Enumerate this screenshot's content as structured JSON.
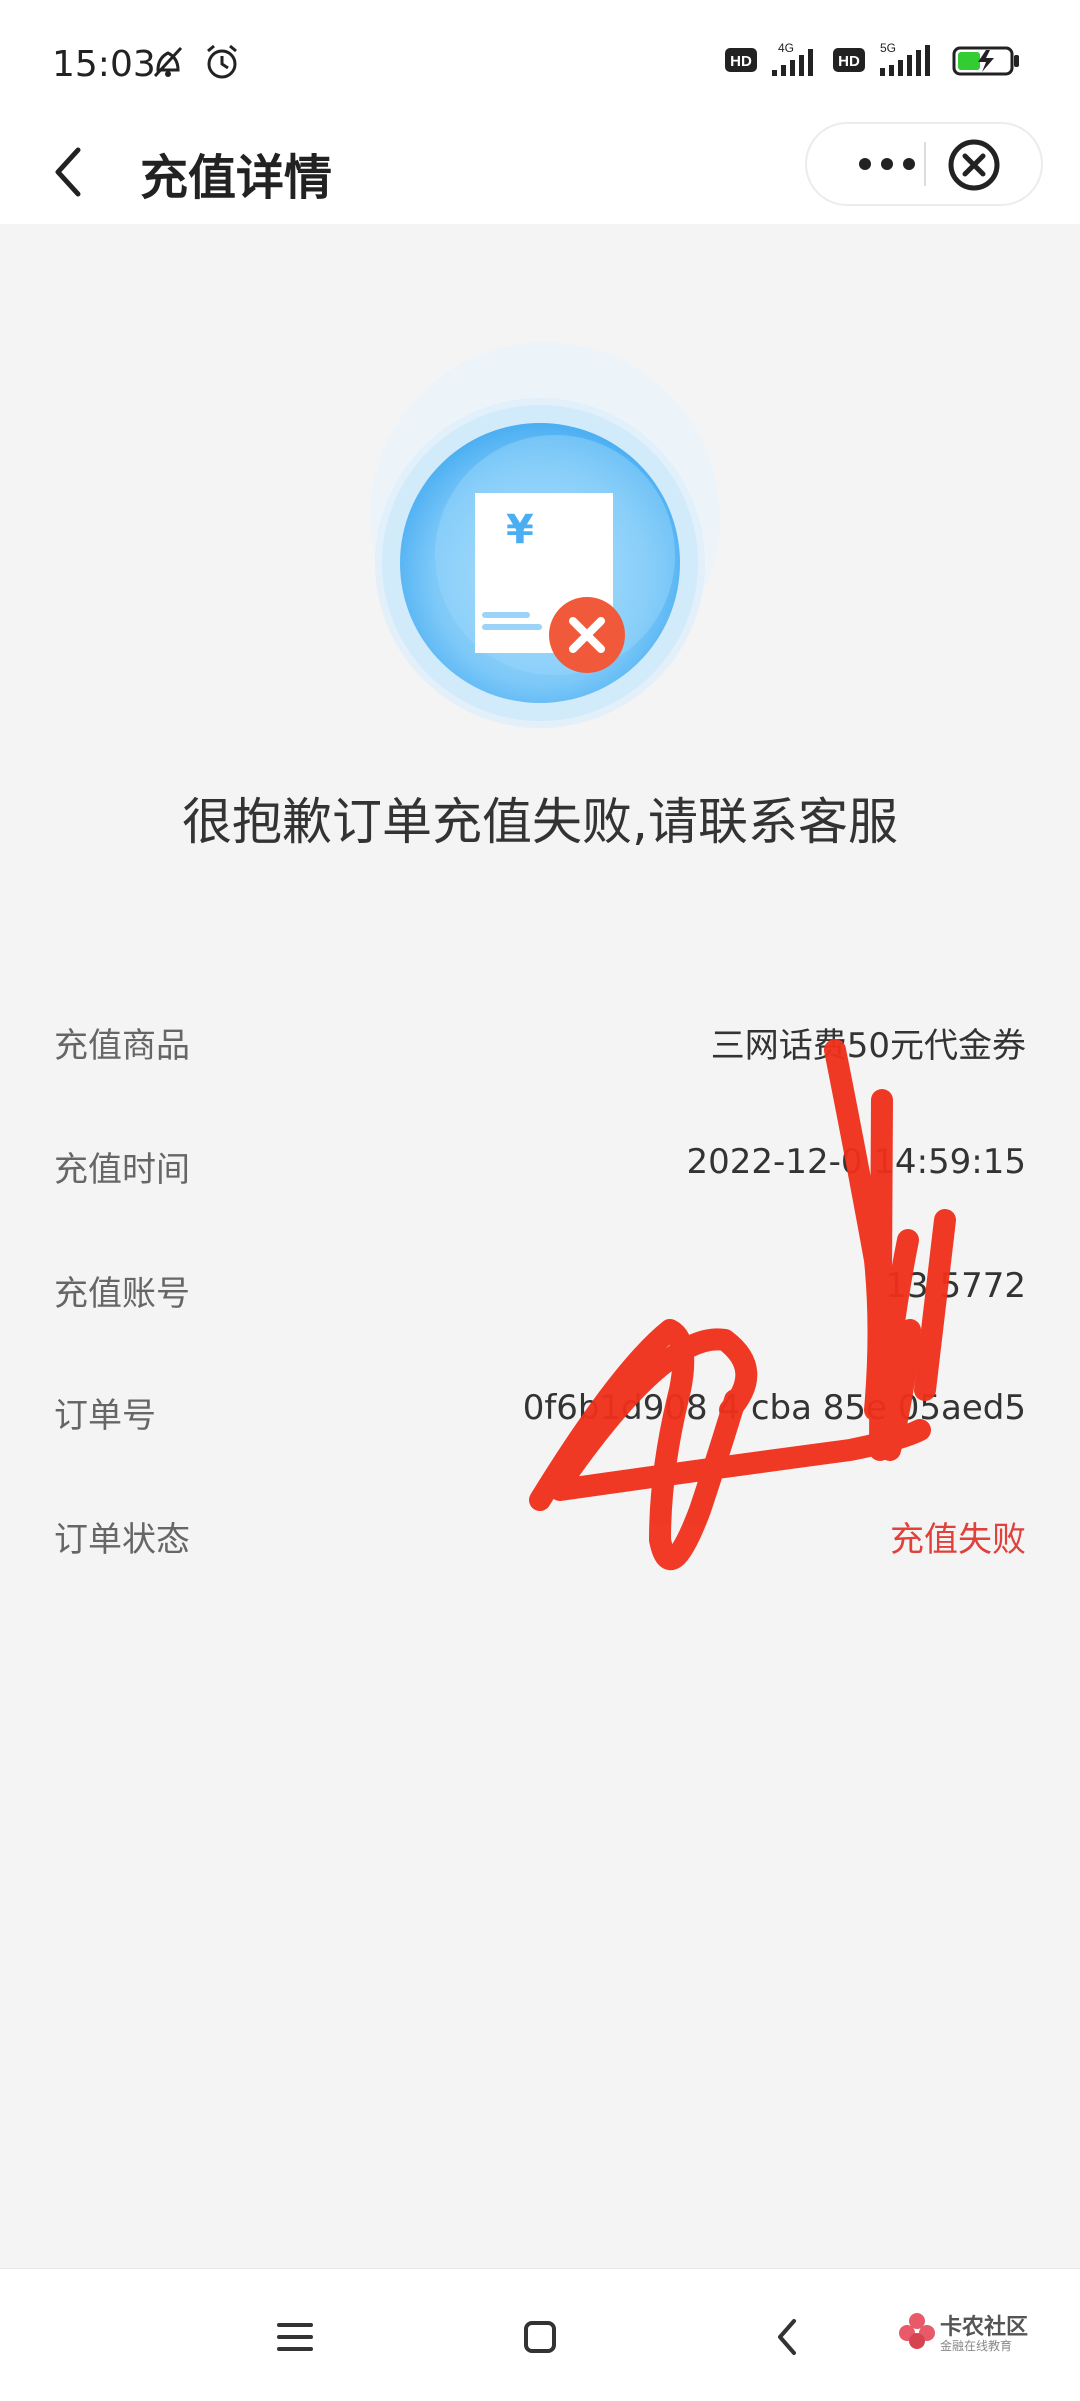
{
  "status_bar": {
    "time": "15:03",
    "network_badges": [
      "HD",
      "4G",
      "HD",
      "5G"
    ],
    "icons": [
      "bell-off-icon",
      "alarm-icon",
      "signal-icon",
      "battery-charging-icon"
    ],
    "battery_color": "#33cc33"
  },
  "header": {
    "title": "充值详情",
    "back_icon": "chevron-left-icon",
    "more_icon": "more-dots-icon",
    "close_icon": "close-circle-icon"
  },
  "result": {
    "icon": "receipt-failed-icon",
    "currency_symbol": "¥",
    "message": "很抱歉订单充值失败,请联系客服"
  },
  "details": [
    {
      "label": "充值商品",
      "value": "三网话费50元代金券"
    },
    {
      "label": "充值时间",
      "value": "2022-12-0 14:59:15"
    },
    {
      "label": "充值账号",
      "value": "13 5772"
    },
    {
      "label": "订单号",
      "value": "0f6b1d908 4 cba 85e 05aed5"
    },
    {
      "label": "订单状态",
      "value": "充值失败",
      "status": "fail"
    }
  ],
  "colors": {
    "fail_text": "#e0413a",
    "accent_blue": "#42a5f5",
    "scribble_red": "#f0301a"
  },
  "nav_bar": {
    "icons": [
      "menu-icon",
      "home-square-icon",
      "back-triangle-icon"
    ]
  },
  "watermark": {
    "name": "卡农社区",
    "sub": "金融在线教育"
  }
}
